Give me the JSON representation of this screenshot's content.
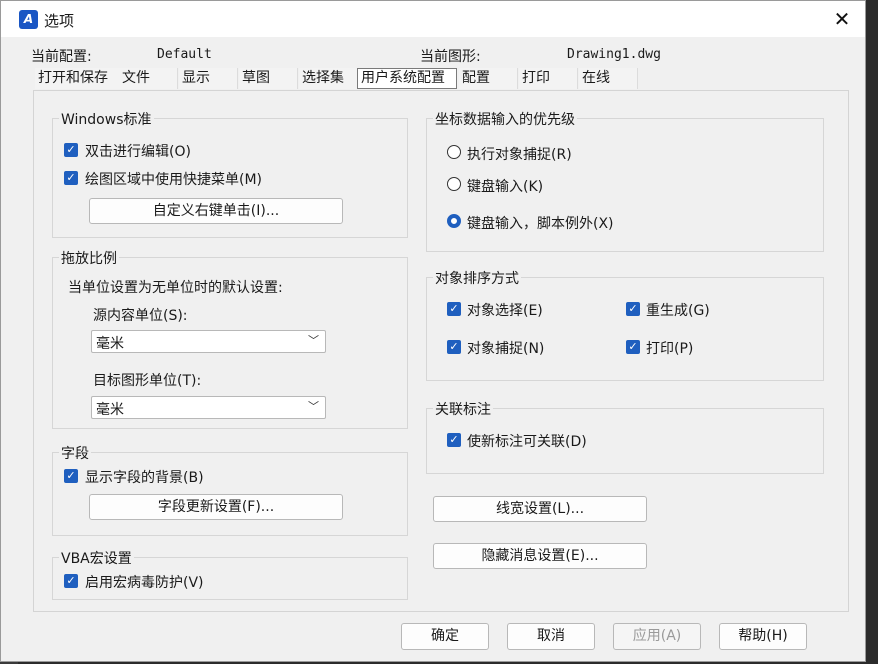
{
  "window": {
    "title": "选项",
    "close_label": "✕",
    "app_icon": "A"
  },
  "info": {
    "config_label": "当前配置:",
    "config_value": "Default",
    "drawing_label": "当前图形:",
    "drawing_value": "Drawing1.dwg"
  },
  "tabs": [
    "打开和保存",
    "文件",
    "显示",
    "草图",
    "选择集",
    "用户系统配置",
    "配置",
    "打印",
    "在线"
  ],
  "windows_std": {
    "title": "Windows标准",
    "dblclick": "双击进行编辑(O)",
    "shortcut_menu": "绘图区域中使用快捷菜单(M)",
    "rightclick_btn": "自定义右键单击(I)..."
  },
  "scale": {
    "title": "拖放比例",
    "desc": "当单位设置为无单位时的默认设置:",
    "source_label": "源内容单位(S):",
    "source_value": "毫米",
    "target_label": "目标图形单位(T):",
    "target_value": "毫米"
  },
  "field": {
    "title": "字段",
    "show_bg": "显示字段的背景(B)",
    "update_btn": "字段更新设置(F)..."
  },
  "vba": {
    "title": "VBA宏设置",
    "virus": "启用宏病毒防护(V)"
  },
  "coord": {
    "title": "坐标数据输入的优先级",
    "opt1": "执行对象捕捉(R)",
    "opt2": "键盘输入(K)",
    "opt3": "键盘输入，脚本例外(X)"
  },
  "sort": {
    "title": "对象排序方式",
    "select": "对象选择(E)",
    "regen": "重生成(G)",
    "snap": "对象捕捉(N)",
    "plot": "打印(P)"
  },
  "dim": {
    "title": "关联标注",
    "assoc": "使新标注可关联(D)"
  },
  "buttons": {
    "lineweight": "线宽设置(L)...",
    "hidden_msg": "隐藏消息设置(E)...",
    "ok": "确定",
    "cancel": "取消",
    "apply": "应用(A)",
    "help": "帮助(H)"
  }
}
